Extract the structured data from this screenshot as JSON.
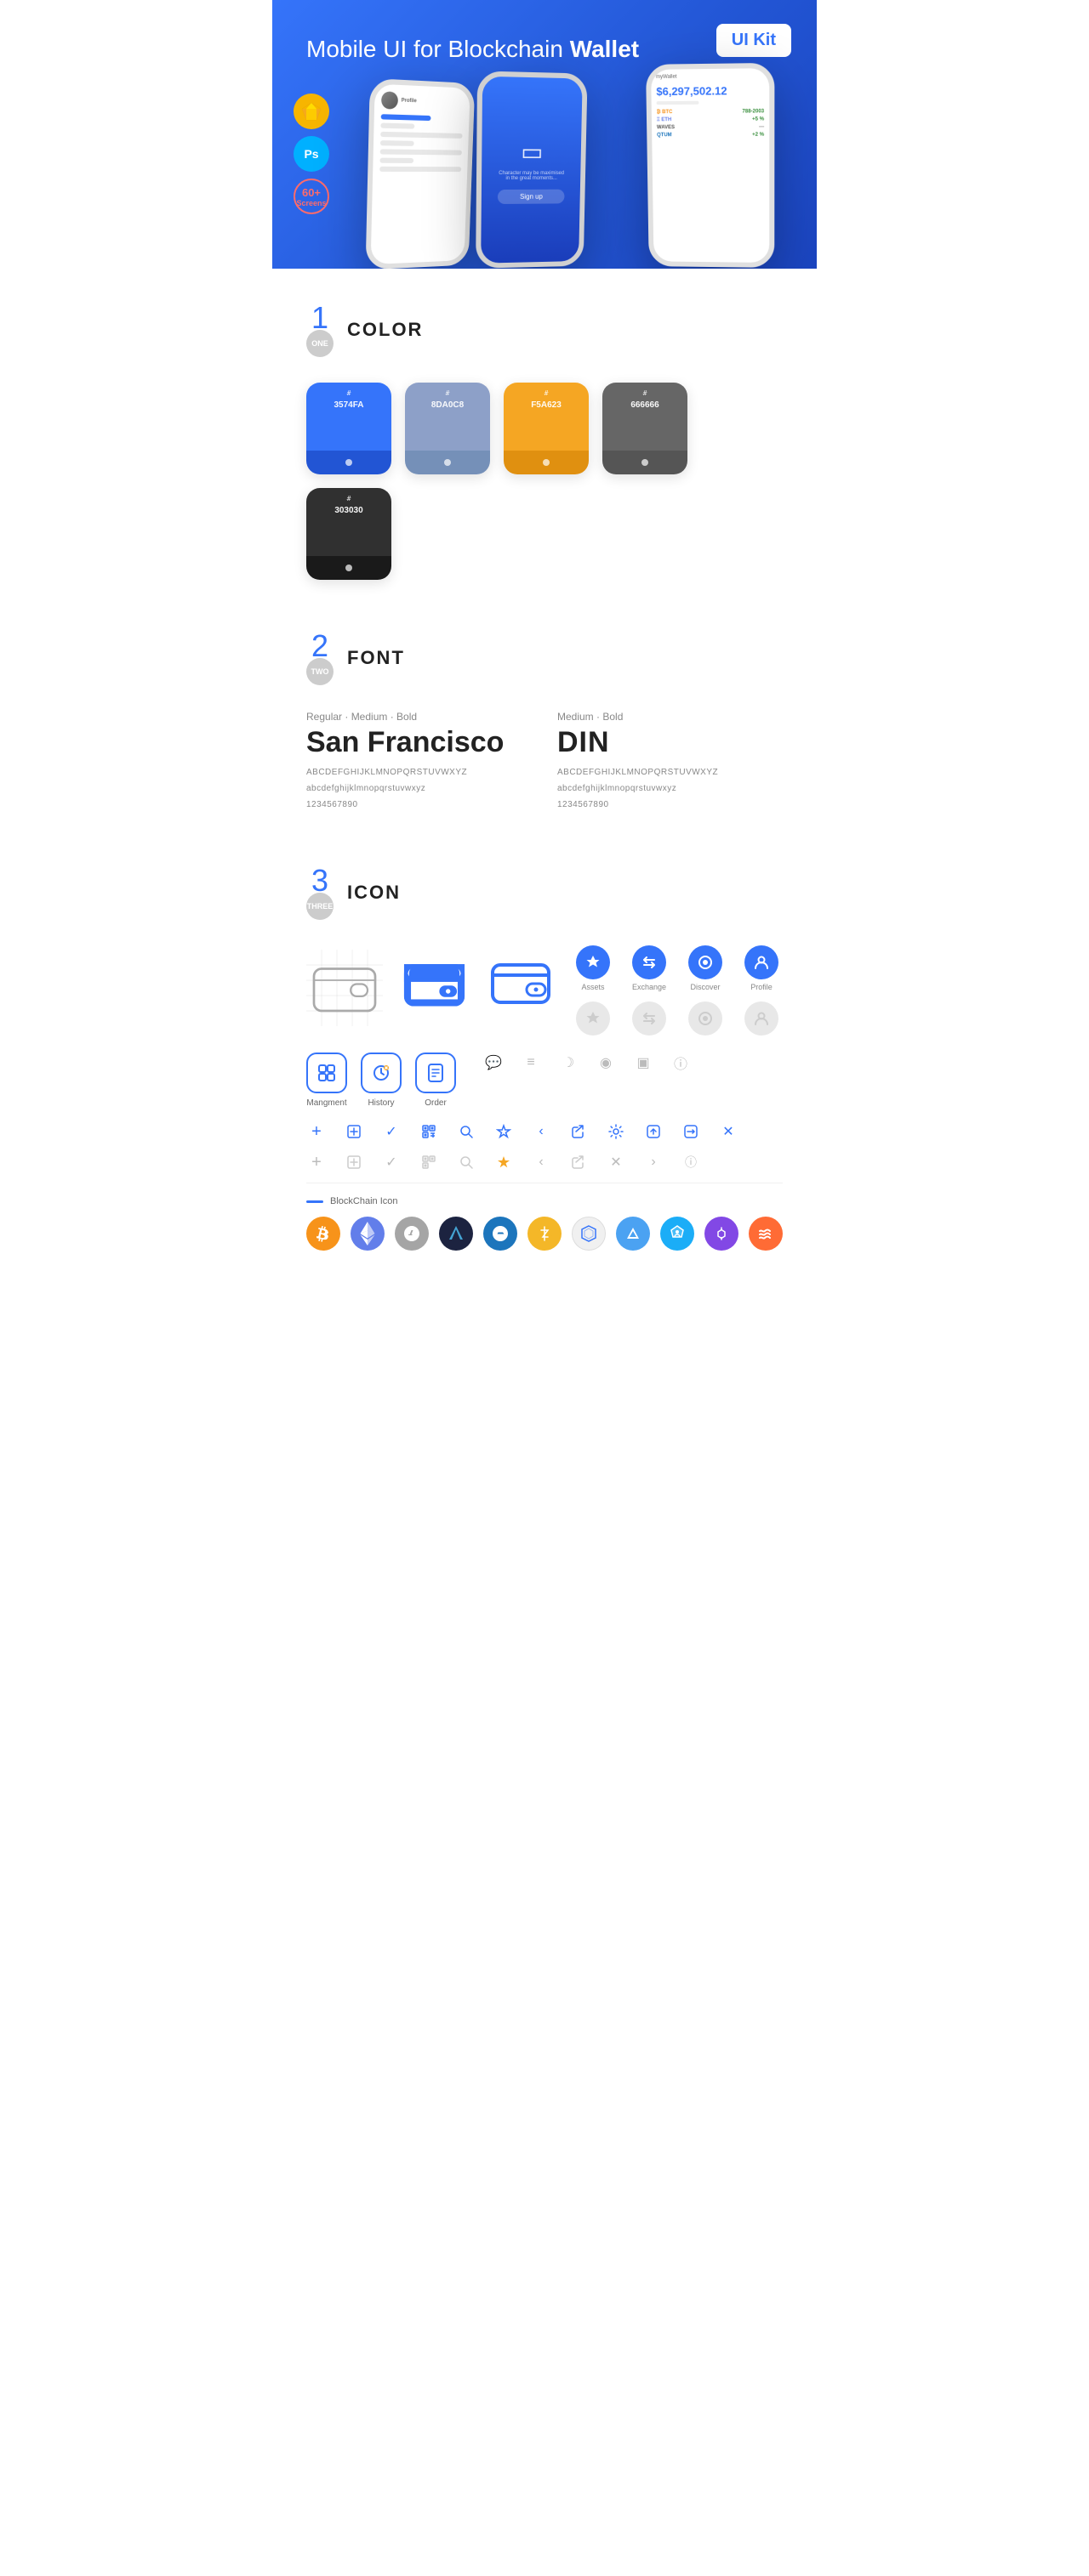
{
  "hero": {
    "title": "Mobile UI for Blockchain ",
    "title_bold": "Wallet",
    "badge": "UI Kit",
    "sketch_label": "Sk",
    "ps_label": "Ps",
    "screens_num": "60+",
    "screens_label": "Screens"
  },
  "section1": {
    "number": "1",
    "number_label": "ONE",
    "title": "COLOR",
    "colors": [
      {
        "hex": "#3574FA",
        "code": "#\n3574FA"
      },
      {
        "hex": "#8DA0C8",
        "code": "#\n8DA0C8"
      },
      {
        "hex": "#F5A623",
        "code": "#\nF5A623"
      },
      {
        "hex": "#666666",
        "code": "#\n666666"
      },
      {
        "hex": "#303030",
        "code": "#\n303030"
      }
    ]
  },
  "section2": {
    "number": "2",
    "number_label": "TWO",
    "title": "FONT",
    "font1": {
      "label": "Regular · Medium · Bold",
      "name": "San Francisco",
      "upper": "ABCDEFGHIJKLMNOPQRSTUVWXYZ",
      "lower": "abcdefghijklmnopqrstuvwxyz",
      "digits": "1234567890"
    },
    "font2": {
      "label": "Medium · Bold",
      "name": "DIN",
      "upper": "ABCDEFGHIJKLMNOPQRSTUVWXYZ",
      "lower": "abcdefghijklmnopqrstuvwxyz",
      "digits": "1234567890"
    }
  },
  "section3": {
    "number": "3",
    "number_label": "THREE",
    "title": "ICON",
    "nav_icons": [
      {
        "label": "Assets",
        "filled": true
      },
      {
        "label": "Exchange",
        "filled": true
      },
      {
        "label": "Discover",
        "filled": true
      },
      {
        "label": "Profile",
        "filled": true
      }
    ],
    "nav_icons_gray": [
      {
        "label": "",
        "filled": false
      },
      {
        "label": "",
        "filled": false
      },
      {
        "label": "",
        "filled": false
      },
      {
        "label": "",
        "filled": false
      }
    ],
    "medium_icons": [
      {
        "label": "Mangment"
      },
      {
        "label": "History"
      },
      {
        "label": "Order"
      }
    ],
    "blockchain_label": "BlockChain Icon",
    "crypto": [
      {
        "symbol": "₿",
        "class": "crypto-btc"
      },
      {
        "symbol": "Ξ",
        "class": "crypto-eth"
      },
      {
        "symbol": "Ł",
        "class": "crypto-ltc"
      },
      {
        "symbol": "◆",
        "class": "crypto-wings"
      },
      {
        "symbol": "D",
        "class": "crypto-dash"
      },
      {
        "symbol": "Z",
        "class": "crypto-zcash"
      },
      {
        "symbol": "⬡",
        "class": "crypto-grid"
      },
      {
        "symbol": "▲",
        "class": "crypto-steem"
      },
      {
        "symbol": "◈",
        "class": "crypto-aragon"
      },
      {
        "symbol": "▼",
        "class": "crypto-matic"
      },
      {
        "symbol": "~",
        "class": "crypto-sxp"
      }
    ]
  }
}
